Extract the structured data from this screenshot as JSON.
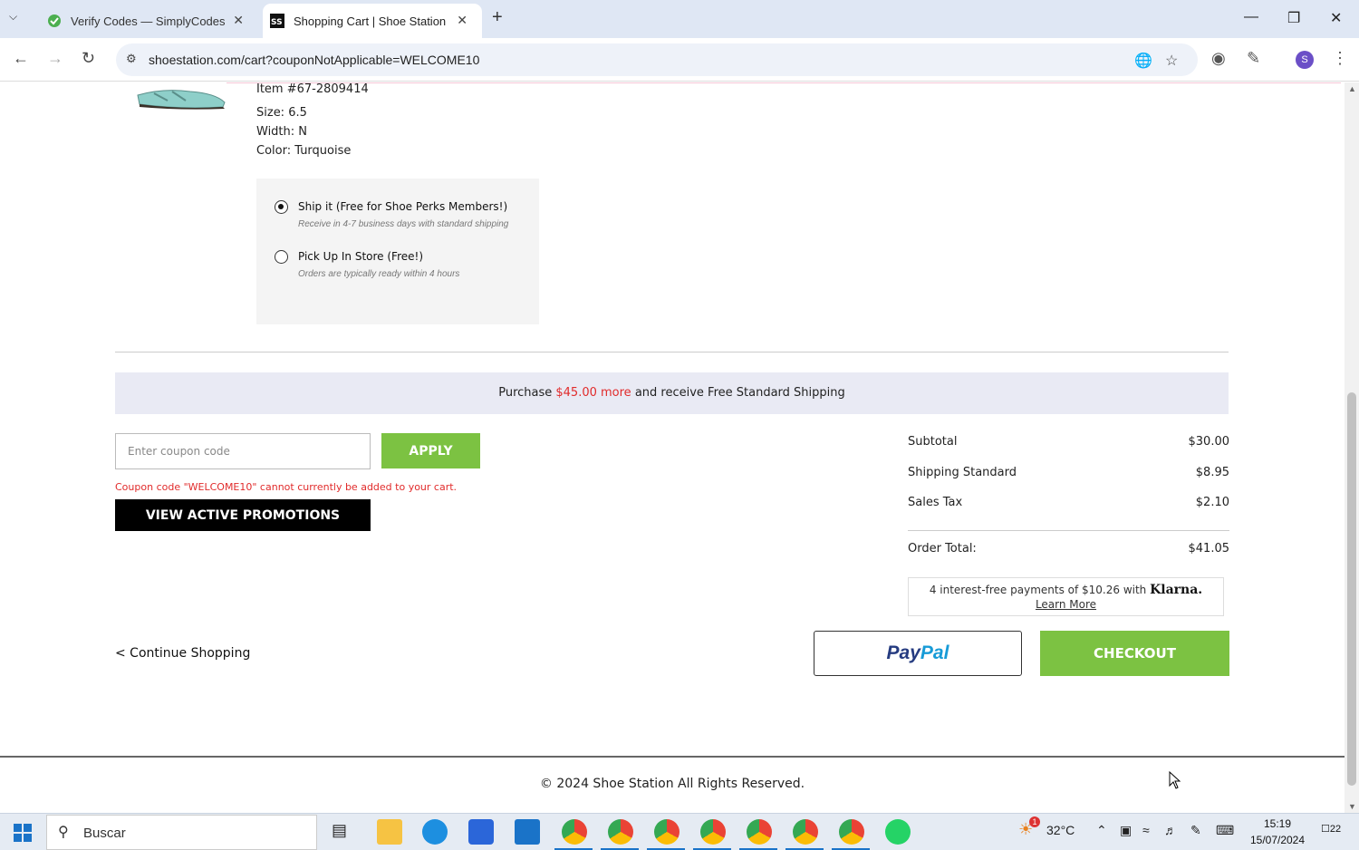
{
  "browser": {
    "tabs": [
      {
        "title": "Verify Codes — SimplyCodes",
        "active": false
      },
      {
        "title": "Shopping Cart | Shoe Station",
        "active": true
      }
    ],
    "url": "shoestation.com/cart?couponNotApplicable=WELCOME10",
    "profile_initial": "S"
  },
  "item": {
    "number": "Item #67-2809414",
    "size": "Size: 6.5",
    "width": "Width: N",
    "color": "Color: Turquoise"
  },
  "shipping_options": [
    {
      "title": "Ship it (Free for Shoe Perks Members!)",
      "subtitle": "Receive in 4-7 business days with standard shipping",
      "selected": true
    },
    {
      "title": "Pick Up In Store (Free!)",
      "subtitle": "Orders are typically ready within 4 hours",
      "selected": false
    }
  ],
  "banner": {
    "prefix": "Purchase ",
    "amount": "$45.00 more",
    "suffix": " and receive Free Standard Shipping"
  },
  "coupon": {
    "placeholder": "Enter coupon code",
    "apply_label": "APPLY",
    "error": "Coupon code \"WELCOME10\" cannot currently be added to your cart.",
    "promotions_label": "VIEW ACTIVE PROMOTIONS"
  },
  "summary": {
    "subtotal_label": "Subtotal",
    "subtotal": "$30.00",
    "shipping_label": "Shipping Standard",
    "shipping": "$8.95",
    "tax_label": "Sales Tax",
    "tax": "$2.10",
    "total_label": "Order Total:",
    "total": "$41.05"
  },
  "klarna": {
    "text": "4 interest-free payments of $10.26 with ",
    "brand": "Klarna.",
    "learn_more": "Learn More"
  },
  "actions": {
    "continue_label": "< Continue Shopping",
    "paypal_pay": "Pay",
    "paypal_pal": "Pal",
    "checkout_label": "CHECKOUT"
  },
  "footer": {
    "copyright": "© 2024 Shoe Station All Rights Reserved."
  },
  "taskbar": {
    "search_placeholder": "Buscar",
    "weather": "32°C",
    "weather_badge": "1",
    "time": "15:19",
    "date": "15/07/2024",
    "notifications": "22"
  },
  "colors": {
    "accent_green": "#7cc242",
    "error_red": "#e12b2b",
    "banner_bg": "#e9eaf4"
  }
}
